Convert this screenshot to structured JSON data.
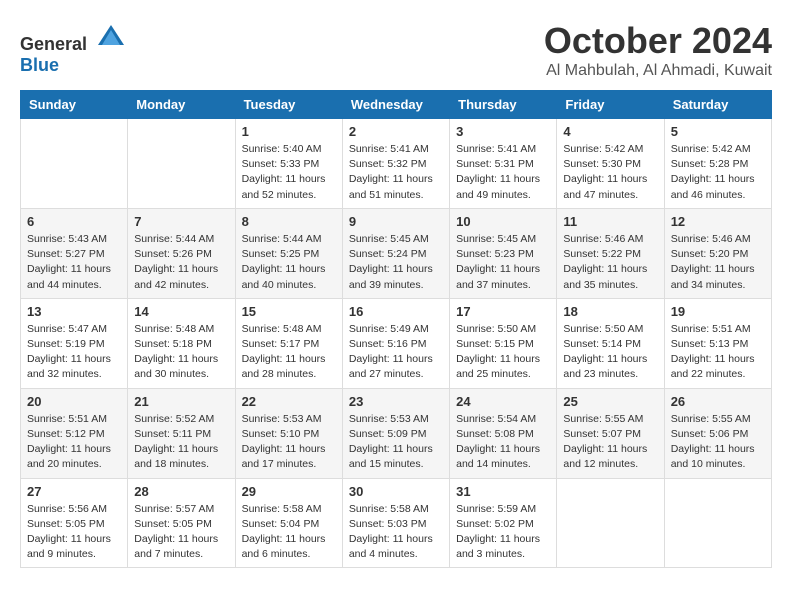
{
  "header": {
    "logo_general": "General",
    "logo_blue": "Blue",
    "month": "October 2024",
    "location": "Al Mahbulah, Al Ahmadi, Kuwait"
  },
  "weekdays": [
    "Sunday",
    "Monday",
    "Tuesday",
    "Wednesday",
    "Thursday",
    "Friday",
    "Saturday"
  ],
  "weeks": [
    [
      {
        "day": "",
        "sunrise": "",
        "sunset": "",
        "daylight": ""
      },
      {
        "day": "",
        "sunrise": "",
        "sunset": "",
        "daylight": ""
      },
      {
        "day": "1",
        "sunrise": "Sunrise: 5:40 AM",
        "sunset": "Sunset: 5:33 PM",
        "daylight": "Daylight: 11 hours and 52 minutes."
      },
      {
        "day": "2",
        "sunrise": "Sunrise: 5:41 AM",
        "sunset": "Sunset: 5:32 PM",
        "daylight": "Daylight: 11 hours and 51 minutes."
      },
      {
        "day": "3",
        "sunrise": "Sunrise: 5:41 AM",
        "sunset": "Sunset: 5:31 PM",
        "daylight": "Daylight: 11 hours and 49 minutes."
      },
      {
        "day": "4",
        "sunrise": "Sunrise: 5:42 AM",
        "sunset": "Sunset: 5:30 PM",
        "daylight": "Daylight: 11 hours and 47 minutes."
      },
      {
        "day": "5",
        "sunrise": "Sunrise: 5:42 AM",
        "sunset": "Sunset: 5:28 PM",
        "daylight": "Daylight: 11 hours and 46 minutes."
      }
    ],
    [
      {
        "day": "6",
        "sunrise": "Sunrise: 5:43 AM",
        "sunset": "Sunset: 5:27 PM",
        "daylight": "Daylight: 11 hours and 44 minutes."
      },
      {
        "day": "7",
        "sunrise": "Sunrise: 5:44 AM",
        "sunset": "Sunset: 5:26 PM",
        "daylight": "Daylight: 11 hours and 42 minutes."
      },
      {
        "day": "8",
        "sunrise": "Sunrise: 5:44 AM",
        "sunset": "Sunset: 5:25 PM",
        "daylight": "Daylight: 11 hours and 40 minutes."
      },
      {
        "day": "9",
        "sunrise": "Sunrise: 5:45 AM",
        "sunset": "Sunset: 5:24 PM",
        "daylight": "Daylight: 11 hours and 39 minutes."
      },
      {
        "day": "10",
        "sunrise": "Sunrise: 5:45 AM",
        "sunset": "Sunset: 5:23 PM",
        "daylight": "Daylight: 11 hours and 37 minutes."
      },
      {
        "day": "11",
        "sunrise": "Sunrise: 5:46 AM",
        "sunset": "Sunset: 5:22 PM",
        "daylight": "Daylight: 11 hours and 35 minutes."
      },
      {
        "day": "12",
        "sunrise": "Sunrise: 5:46 AM",
        "sunset": "Sunset: 5:20 PM",
        "daylight": "Daylight: 11 hours and 34 minutes."
      }
    ],
    [
      {
        "day": "13",
        "sunrise": "Sunrise: 5:47 AM",
        "sunset": "Sunset: 5:19 PM",
        "daylight": "Daylight: 11 hours and 32 minutes."
      },
      {
        "day": "14",
        "sunrise": "Sunrise: 5:48 AM",
        "sunset": "Sunset: 5:18 PM",
        "daylight": "Daylight: 11 hours and 30 minutes."
      },
      {
        "day": "15",
        "sunrise": "Sunrise: 5:48 AM",
        "sunset": "Sunset: 5:17 PM",
        "daylight": "Daylight: 11 hours and 28 minutes."
      },
      {
        "day": "16",
        "sunrise": "Sunrise: 5:49 AM",
        "sunset": "Sunset: 5:16 PM",
        "daylight": "Daylight: 11 hours and 27 minutes."
      },
      {
        "day": "17",
        "sunrise": "Sunrise: 5:50 AM",
        "sunset": "Sunset: 5:15 PM",
        "daylight": "Daylight: 11 hours and 25 minutes."
      },
      {
        "day": "18",
        "sunrise": "Sunrise: 5:50 AM",
        "sunset": "Sunset: 5:14 PM",
        "daylight": "Daylight: 11 hours and 23 minutes."
      },
      {
        "day": "19",
        "sunrise": "Sunrise: 5:51 AM",
        "sunset": "Sunset: 5:13 PM",
        "daylight": "Daylight: 11 hours and 22 minutes."
      }
    ],
    [
      {
        "day": "20",
        "sunrise": "Sunrise: 5:51 AM",
        "sunset": "Sunset: 5:12 PM",
        "daylight": "Daylight: 11 hours and 20 minutes."
      },
      {
        "day": "21",
        "sunrise": "Sunrise: 5:52 AM",
        "sunset": "Sunset: 5:11 PM",
        "daylight": "Daylight: 11 hours and 18 minutes."
      },
      {
        "day": "22",
        "sunrise": "Sunrise: 5:53 AM",
        "sunset": "Sunset: 5:10 PM",
        "daylight": "Daylight: 11 hours and 17 minutes."
      },
      {
        "day": "23",
        "sunrise": "Sunrise: 5:53 AM",
        "sunset": "Sunset: 5:09 PM",
        "daylight": "Daylight: 11 hours and 15 minutes."
      },
      {
        "day": "24",
        "sunrise": "Sunrise: 5:54 AM",
        "sunset": "Sunset: 5:08 PM",
        "daylight": "Daylight: 11 hours and 14 minutes."
      },
      {
        "day": "25",
        "sunrise": "Sunrise: 5:55 AM",
        "sunset": "Sunset: 5:07 PM",
        "daylight": "Daylight: 11 hours and 12 minutes."
      },
      {
        "day": "26",
        "sunrise": "Sunrise: 5:55 AM",
        "sunset": "Sunset: 5:06 PM",
        "daylight": "Daylight: 11 hours and 10 minutes."
      }
    ],
    [
      {
        "day": "27",
        "sunrise": "Sunrise: 5:56 AM",
        "sunset": "Sunset: 5:05 PM",
        "daylight": "Daylight: 11 hours and 9 minutes."
      },
      {
        "day": "28",
        "sunrise": "Sunrise: 5:57 AM",
        "sunset": "Sunset: 5:05 PM",
        "daylight": "Daylight: 11 hours and 7 minutes."
      },
      {
        "day": "29",
        "sunrise": "Sunrise: 5:58 AM",
        "sunset": "Sunset: 5:04 PM",
        "daylight": "Daylight: 11 hours and 6 minutes."
      },
      {
        "day": "30",
        "sunrise": "Sunrise: 5:58 AM",
        "sunset": "Sunset: 5:03 PM",
        "daylight": "Daylight: 11 hours and 4 minutes."
      },
      {
        "day": "31",
        "sunrise": "Sunrise: 5:59 AM",
        "sunset": "Sunset: 5:02 PM",
        "daylight": "Daylight: 11 hours and 3 minutes."
      },
      {
        "day": "",
        "sunrise": "",
        "sunset": "",
        "daylight": ""
      },
      {
        "day": "",
        "sunrise": "",
        "sunset": "",
        "daylight": ""
      }
    ]
  ]
}
